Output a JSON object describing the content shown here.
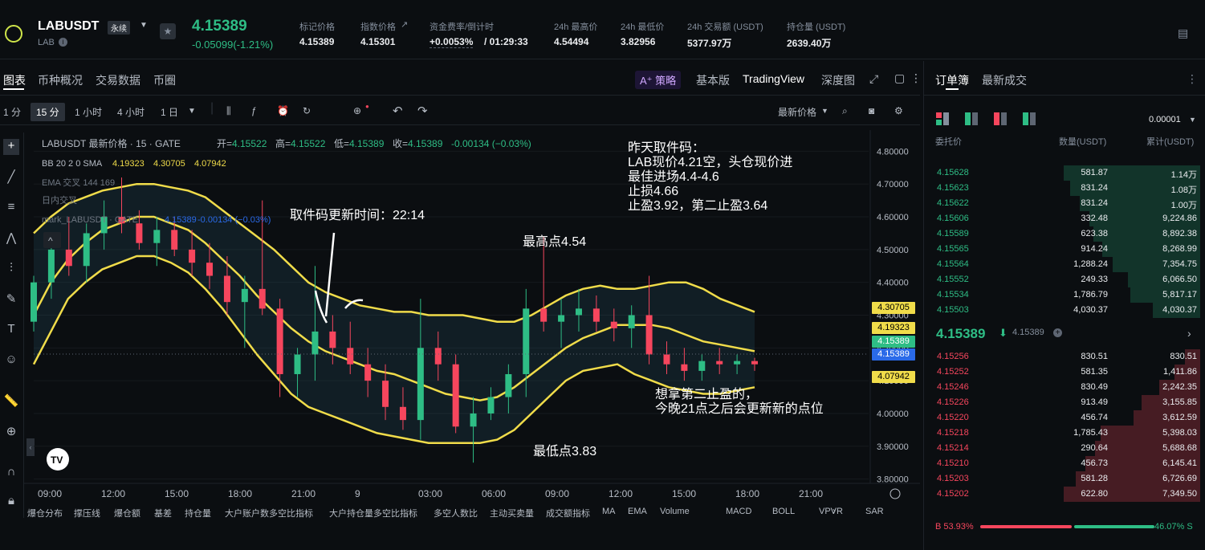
{
  "header": {
    "symbol": "LABUSDT",
    "contract_type": "永续",
    "base": "LAB",
    "price": "4.15389",
    "change": "-0.05099(-1.21%)",
    "stats": [
      {
        "label": "标记价格",
        "value": "4.15389"
      },
      {
        "label": "指数价格",
        "value": "4.15301"
      },
      {
        "label": "资金费率/倒计时",
        "value": "+0.0053%",
        "countdown": "/ 01:29:33"
      },
      {
        "label": "24h 最高价",
        "value": "4.54494"
      },
      {
        "label": "24h 最低价",
        "value": "3.82956"
      },
      {
        "label": "24h 交易额 (USDT)",
        "value": "5377.97万"
      },
      {
        "label": "持仓量 (USDT)",
        "value": "2639.40万"
      }
    ]
  },
  "tabs": [
    "图表",
    "币种概况",
    "交易数据",
    "币圈"
  ],
  "right_tabs": {
    "ai": "A⁺ 策略",
    "basic": "基本版",
    "tv": "TradingView",
    "depth": "深度图"
  },
  "toolbar": {
    "intervals": [
      "1 分",
      "15 分",
      "1 小时",
      "4 小时",
      "1 日"
    ],
    "price_type": "最新价格"
  },
  "legend": {
    "line1": {
      "title": "LABUSDT 最新价格 · 15 · GATE",
      "open_k": "开=",
      "open": "4.15522",
      "high_k": "高=",
      "high": "4.15522",
      "low_k": "低=",
      "low": "4.15389",
      "close_k": "收=",
      "close": "4.15389",
      "chg": "-0.00134 (−0.03%)"
    },
    "line2": {
      "title": "BB 20 2 0 SMA",
      "v1": "4.19323",
      "v2": "4.30705",
      "v3": "4.07942"
    },
    "line3": "EMA 交叉 144 169",
    "line4": "日内交叉",
    "line5": {
      "title": "mark_LABUSDT · GATE",
      "v": "4.15389",
      "chg": "-0.00134 (−0.03%)"
    }
  },
  "annotations": {
    "update_time": "取件码更新时间：22:14",
    "yesterday": [
      "昨天取件码：",
      "LAB现价4.21空，头仓现价进",
      "最佳进场4.4-4.6",
      "止损4.66",
      "止盈3.92，第二止盈3.64"
    ],
    "high": "最高点4.54",
    "low": "最低点3.83",
    "note": [
      "想拿第二止盈的，",
      "今晚21点之后会更新新的点位"
    ]
  },
  "price_axis": [
    "4.80000",
    "4.70000",
    "4.60000",
    "4.50000",
    "4.40000",
    "4.30000",
    "4.20000",
    "4.10000",
    "4.00000",
    "3.90000",
    "3.80000"
  ],
  "price_tags": [
    {
      "v": "4.30705",
      "color": "#f0dc4a"
    },
    {
      "v": "4.19323",
      "color": "#f0dc4a"
    },
    {
      "v": "4.15389",
      "color": "#2ebd85"
    },
    {
      "v": "4.15389",
      "color": "#2a6ae8"
    },
    {
      "v": "4.07942",
      "color": "#f0dc4a"
    }
  ],
  "time_axis": [
    "09:00",
    "12:00",
    "15:00",
    "18:00",
    "21:00",
    "9",
    "03:00",
    "06:00",
    "09:00",
    "12:00",
    "15:00",
    "18:00",
    "21:00"
  ],
  "bottom_indicators": [
    "爆仓分布",
    "撑压线",
    "爆仓额",
    "基差",
    "持仓量",
    "大户账户数多空比指标",
    "大户持仓量多空比指标",
    "多空人数比",
    "主动买卖量",
    "成交额指标",
    "MA",
    "EMA",
    "Volume",
    "MACD",
    "BOLL",
    "VPVR",
    "SAR"
  ],
  "chart_data": {
    "type": "candlestick",
    "ylim": [
      3.75,
      4.85
    ],
    "boll": {
      "upper": [
        4.55,
        4.6,
        4.64,
        4.66,
        4.68,
        4.69,
        4.7,
        4.7,
        4.69,
        4.68,
        4.66,
        4.62,
        4.58,
        4.54,
        4.5,
        4.45,
        4.4,
        4.37,
        4.35,
        4.33,
        4.32,
        4.31,
        4.31,
        4.3,
        4.3,
        4.3,
        4.29,
        4.28,
        4.28,
        4.3,
        4.33,
        4.36,
        4.38,
        4.39,
        4.38,
        4.38,
        4.39,
        4.4,
        4.4,
        4.38,
        4.35,
        4.33,
        4.31
      ],
      "mid": [
        4.3,
        4.4,
        4.47,
        4.52,
        4.56,
        4.58,
        4.6,
        4.6,
        4.58,
        4.56,
        4.52,
        4.47,
        4.42,
        4.36,
        4.31,
        4.26,
        4.22,
        4.19,
        4.17,
        4.15,
        4.13,
        4.12,
        4.1,
        4.08,
        4.06,
        4.05,
        4.04,
        4.05,
        4.08,
        4.12,
        4.16,
        4.2,
        4.23,
        4.25,
        4.27,
        4.27,
        4.27,
        4.26,
        4.24,
        4.22,
        4.21,
        4.2,
        4.19
      ],
      "lower": [
        4.15,
        4.25,
        4.35,
        4.4,
        4.44,
        4.46,
        4.48,
        4.48,
        4.46,
        4.43,
        4.38,
        4.32,
        4.25,
        4.18,
        4.12,
        4.06,
        4.02,
        4.0,
        3.98,
        3.96,
        3.94,
        3.93,
        3.92,
        3.91,
        3.91,
        3.91,
        3.91,
        3.92,
        3.95,
        4.0,
        4.05,
        4.1,
        4.13,
        4.14,
        4.15,
        4.12,
        4.1,
        4.08,
        4.07,
        4.06,
        4.06,
        4.07,
        4.08
      ]
    },
    "candles": [
      [
        4.28,
        4.42,
        4.25,
        4.4
      ],
      [
        4.4,
        4.55,
        4.35,
        4.5
      ],
      [
        4.5,
        4.6,
        4.42,
        4.45
      ],
      [
        4.45,
        4.58,
        4.4,
        4.55
      ],
      [
        4.55,
        4.65,
        4.5,
        4.6
      ],
      [
        4.6,
        4.72,
        4.55,
        4.58
      ],
      [
        4.58,
        4.62,
        4.5,
        4.52
      ],
      [
        4.52,
        4.6,
        4.45,
        4.56
      ],
      [
        4.56,
        4.6,
        4.48,
        4.5
      ],
      [
        4.5,
        4.56,
        4.42,
        4.46
      ],
      [
        4.46,
        4.52,
        4.38,
        4.42
      ],
      [
        4.42,
        4.48,
        4.3,
        4.34
      ],
      [
        4.34,
        4.42,
        4.2,
        4.38
      ],
      [
        4.38,
        4.65,
        4.3,
        4.32
      ],
      [
        4.32,
        4.35,
        4.05,
        4.12
      ],
      [
        4.12,
        4.2,
        4.05,
        4.18
      ],
      [
        4.18,
        4.45,
        4.1,
        4.25
      ],
      [
        4.25,
        4.3,
        4.15,
        4.2
      ],
      [
        4.2,
        4.28,
        4.12,
        4.15
      ],
      [
        4.15,
        4.2,
        4.05,
        4.1
      ],
      [
        4.1,
        4.15,
        3.98,
        4.02
      ],
      [
        4.02,
        4.08,
        3.95,
        3.98
      ],
      [
        3.98,
        4.35,
        3.92,
        4.2
      ],
      [
        4.2,
        4.25,
        4.1,
        4.15
      ],
      [
        4.15,
        4.18,
        3.94,
        3.96
      ],
      [
        3.96,
        4.05,
        3.85,
        4.0
      ],
      [
        4.0,
        4.08,
        3.98,
        4.05
      ],
      [
        4.05,
        4.15,
        4.0,
        4.12
      ],
      [
        4.12,
        4.38,
        4.05,
        4.32
      ],
      [
        4.32,
        4.54,
        4.25,
        4.28
      ],
      [
        4.28,
        4.35,
        4.2,
        4.3
      ],
      [
        4.3,
        4.38,
        4.25,
        4.32
      ],
      [
        4.32,
        4.36,
        4.25,
        4.28
      ],
      [
        4.28,
        4.32,
        4.22,
        4.26
      ],
      [
        4.26,
        4.33,
        4.2,
        4.3
      ],
      [
        4.3,
        4.42,
        4.15,
        4.18
      ],
      [
        4.18,
        4.22,
        4.12,
        4.15
      ],
      [
        4.15,
        4.2,
        4.1,
        4.13
      ],
      [
        4.13,
        4.18,
        4.1,
        4.16
      ],
      [
        4.16,
        4.2,
        4.12,
        4.15
      ],
      [
        4.15,
        4.18,
        4.12,
        4.16
      ],
      [
        4.16,
        4.17,
        4.13,
        4.15
      ]
    ]
  },
  "orderbook": {
    "tabs": [
      "订单簿",
      "最新成交"
    ],
    "precision": "0.00001",
    "headers": [
      "委托价",
      "数量(USDT)",
      "累计(USDT)"
    ],
    "asks": [
      {
        "p": "4.15628",
        "q": "581.87",
        "c": "1.14万",
        "d": 1.0
      },
      {
        "p": "4.15623",
        "q": "831.24",
        "c": "1.08万",
        "d": 0.95
      },
      {
        "p": "4.15622",
        "q": "831.24",
        "c": "1.00万",
        "d": 0.88
      },
      {
        "p": "4.15606",
        "q": "332.48",
        "c": "9,224.86",
        "d": 0.81
      },
      {
        "p": "4.15589",
        "q": "623.38",
        "c": "8,892.38",
        "d": 0.78
      },
      {
        "p": "4.15565",
        "q": "914.24",
        "c": "8,268.99",
        "d": 0.72
      },
      {
        "p": "4.15564",
        "q": "1,288.24",
        "c": "7,354.75",
        "d": 0.64
      },
      {
        "p": "4.15552",
        "q": "249.33",
        "c": "6,066.50",
        "d": 0.53
      },
      {
        "p": "4.15534",
        "q": "1,786.79",
        "c": "5,817.17",
        "d": 0.51
      },
      {
        "p": "4.15503",
        "q": "4,030.37",
        "c": "4,030.37",
        "d": 0.35
      }
    ],
    "mid_price": "4.15389",
    "mid_mark": "4.15389",
    "bids": [
      {
        "p": "4.15256",
        "q": "830.51",
        "c": "830.51",
        "d": 0.11
      },
      {
        "p": "4.15252",
        "q": "581.35",
        "c": "1,411.86",
        "d": 0.19
      },
      {
        "p": "4.15246",
        "q": "830.49",
        "c": "2,242.35",
        "d": 0.3
      },
      {
        "p": "4.15226",
        "q": "913.49",
        "c": "3,155.85",
        "d": 0.43
      },
      {
        "p": "4.15220",
        "q": "456.74",
        "c": "3,612.59",
        "d": 0.49
      },
      {
        "p": "4.15218",
        "q": "1,785.43",
        "c": "5,398.03",
        "d": 0.73
      },
      {
        "p": "4.15214",
        "q": "290.64",
        "c": "5,688.68",
        "d": 0.77
      },
      {
        "p": "4.15210",
        "q": "456.73",
        "c": "6,145.41",
        "d": 0.84
      },
      {
        "p": "4.15203",
        "q": "581.28",
        "c": "6,726.69",
        "d": 0.91
      },
      {
        "p": "4.15202",
        "q": "622.80",
        "c": "7,349.50",
        "d": 1.0
      }
    ],
    "buy_ratio": "B 53.93%",
    "sell_ratio": "46.07% S",
    "buy_share": 0.5393
  },
  "colors": {
    "up": "#2ebd85",
    "down": "#f6465d",
    "boll": "#f0dc4a"
  }
}
